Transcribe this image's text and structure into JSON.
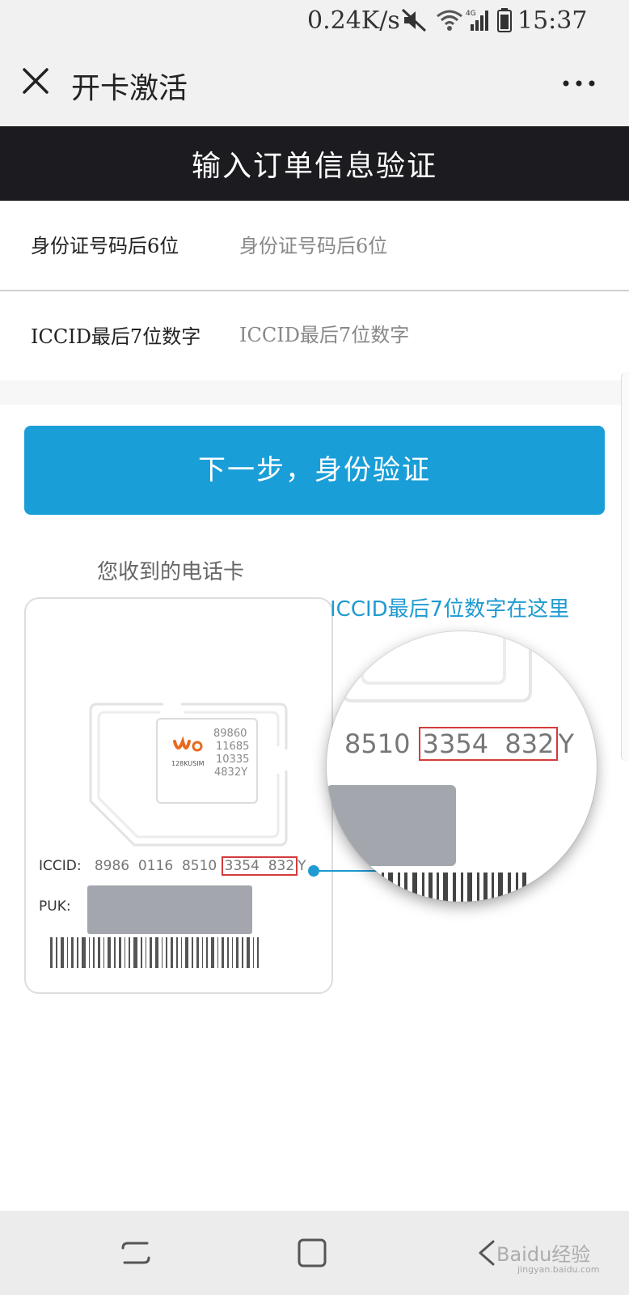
{
  "status_bar": {
    "speed": "0.24K/s",
    "time": "15:37",
    "icons": [
      "mute-icon",
      "wifi-icon",
      "4g-signal-icon",
      "battery-icon"
    ]
  },
  "title_bar": {
    "title": "开卡激活",
    "close_icon": "close-icon",
    "more_icon": "more-icon"
  },
  "header": {
    "title": "输入订单信息验证"
  },
  "form": {
    "id_label": "身份证号码后6位",
    "id_placeholder": "身份证号码后6位",
    "iccid_label": "ICCID最后7位数字",
    "iccid_placeholder": "ICCID最后7位数字"
  },
  "primary_button": {
    "label": "下一步，身份验证",
    "color": "#1a9ed8"
  },
  "illustration": {
    "caption": "您收到的电话卡",
    "callout": "ICCID最后7位数字在这里",
    "chip_numbers": [
      "89860",
      "11685",
      "10335",
      "4832Y"
    ],
    "chip_brand": "128KUSIM",
    "iccid_label": "ICCID:",
    "iccid_prefix": "8986  0116  8510 ",
    "iccid_highlight": "3354  832",
    "iccid_suffix": "Y",
    "puk_label": "PUK:",
    "mag_prefix": "8510 ",
    "mag_highlight": "3354  832",
    "mag_suffix": "Y",
    "highlight_color": "#d43b3b",
    "callout_color": "#1f9ad2"
  },
  "nav_bar": {
    "icons": [
      "recent-apps-icon",
      "home-icon",
      "back-icon"
    ]
  },
  "watermark": {
    "text": "Baidu经验",
    "sub": "jingyan.baidu.com"
  }
}
